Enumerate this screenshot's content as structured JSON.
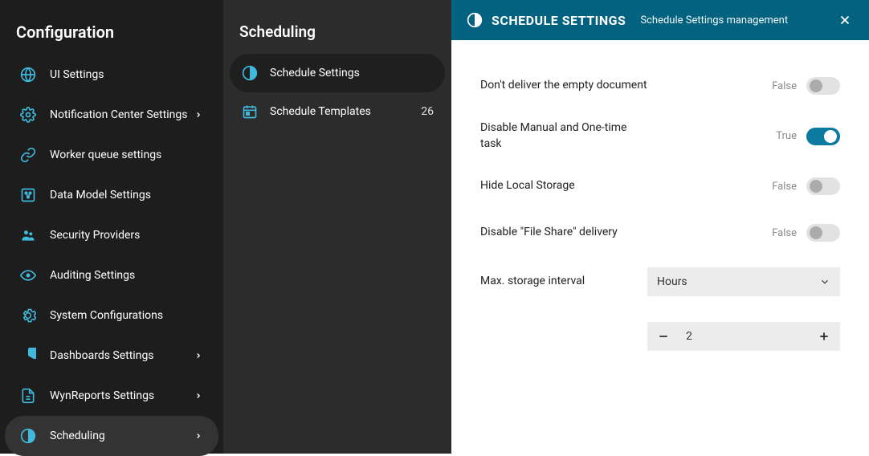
{
  "sidebar_primary": {
    "title": "Configuration",
    "items": [
      {
        "label": "UI Settings",
        "icon": "globe",
        "expandable": false
      },
      {
        "label": "Notification Center Settings",
        "icon": "gear",
        "expandable": true
      },
      {
        "label": "Worker queue settings",
        "icon": "link",
        "expandable": false
      },
      {
        "label": "Data Model Settings",
        "icon": "data-model",
        "expandable": false
      },
      {
        "label": "Security Providers",
        "icon": "users",
        "expandable": false
      },
      {
        "label": "Auditing Settings",
        "icon": "eye",
        "expandable": false
      },
      {
        "label": "System Configurations",
        "icon": "gear",
        "expandable": false
      },
      {
        "label": "Dashboards Settings",
        "icon": "pie",
        "expandable": true
      },
      {
        "label": "WynReports Settings",
        "icon": "document",
        "expandable": true
      },
      {
        "label": "Scheduling",
        "icon": "clock",
        "expandable": true,
        "active": true
      }
    ]
  },
  "sidebar_secondary": {
    "title": "Scheduling",
    "items": [
      {
        "label": "Schedule Settings",
        "icon": "clock",
        "active": true
      },
      {
        "label": "Schedule Templates",
        "icon": "calendar",
        "count": "26"
      }
    ]
  },
  "header": {
    "title": "SCHEDULE SETTINGS",
    "subtitle": "Schedule Settings management"
  },
  "settings": {
    "rows": [
      {
        "label": "Don't deliver the empty document",
        "value_text": "False",
        "value": false
      },
      {
        "label": "Disable Manual and One-time task",
        "value_text": "True",
        "value": true
      },
      {
        "label": "Hide Local Storage",
        "value_text": "False",
        "value": false
      },
      {
        "label": "Disable \"File Share\" delivery",
        "value_text": "False",
        "value": false
      }
    ],
    "interval": {
      "label": "Max. storage interval",
      "unit": "Hours",
      "value": "2"
    }
  },
  "colors": {
    "accent": "#3fb9dc",
    "header_bg": "#03627f",
    "toggle_on": "#0b7aa0"
  }
}
